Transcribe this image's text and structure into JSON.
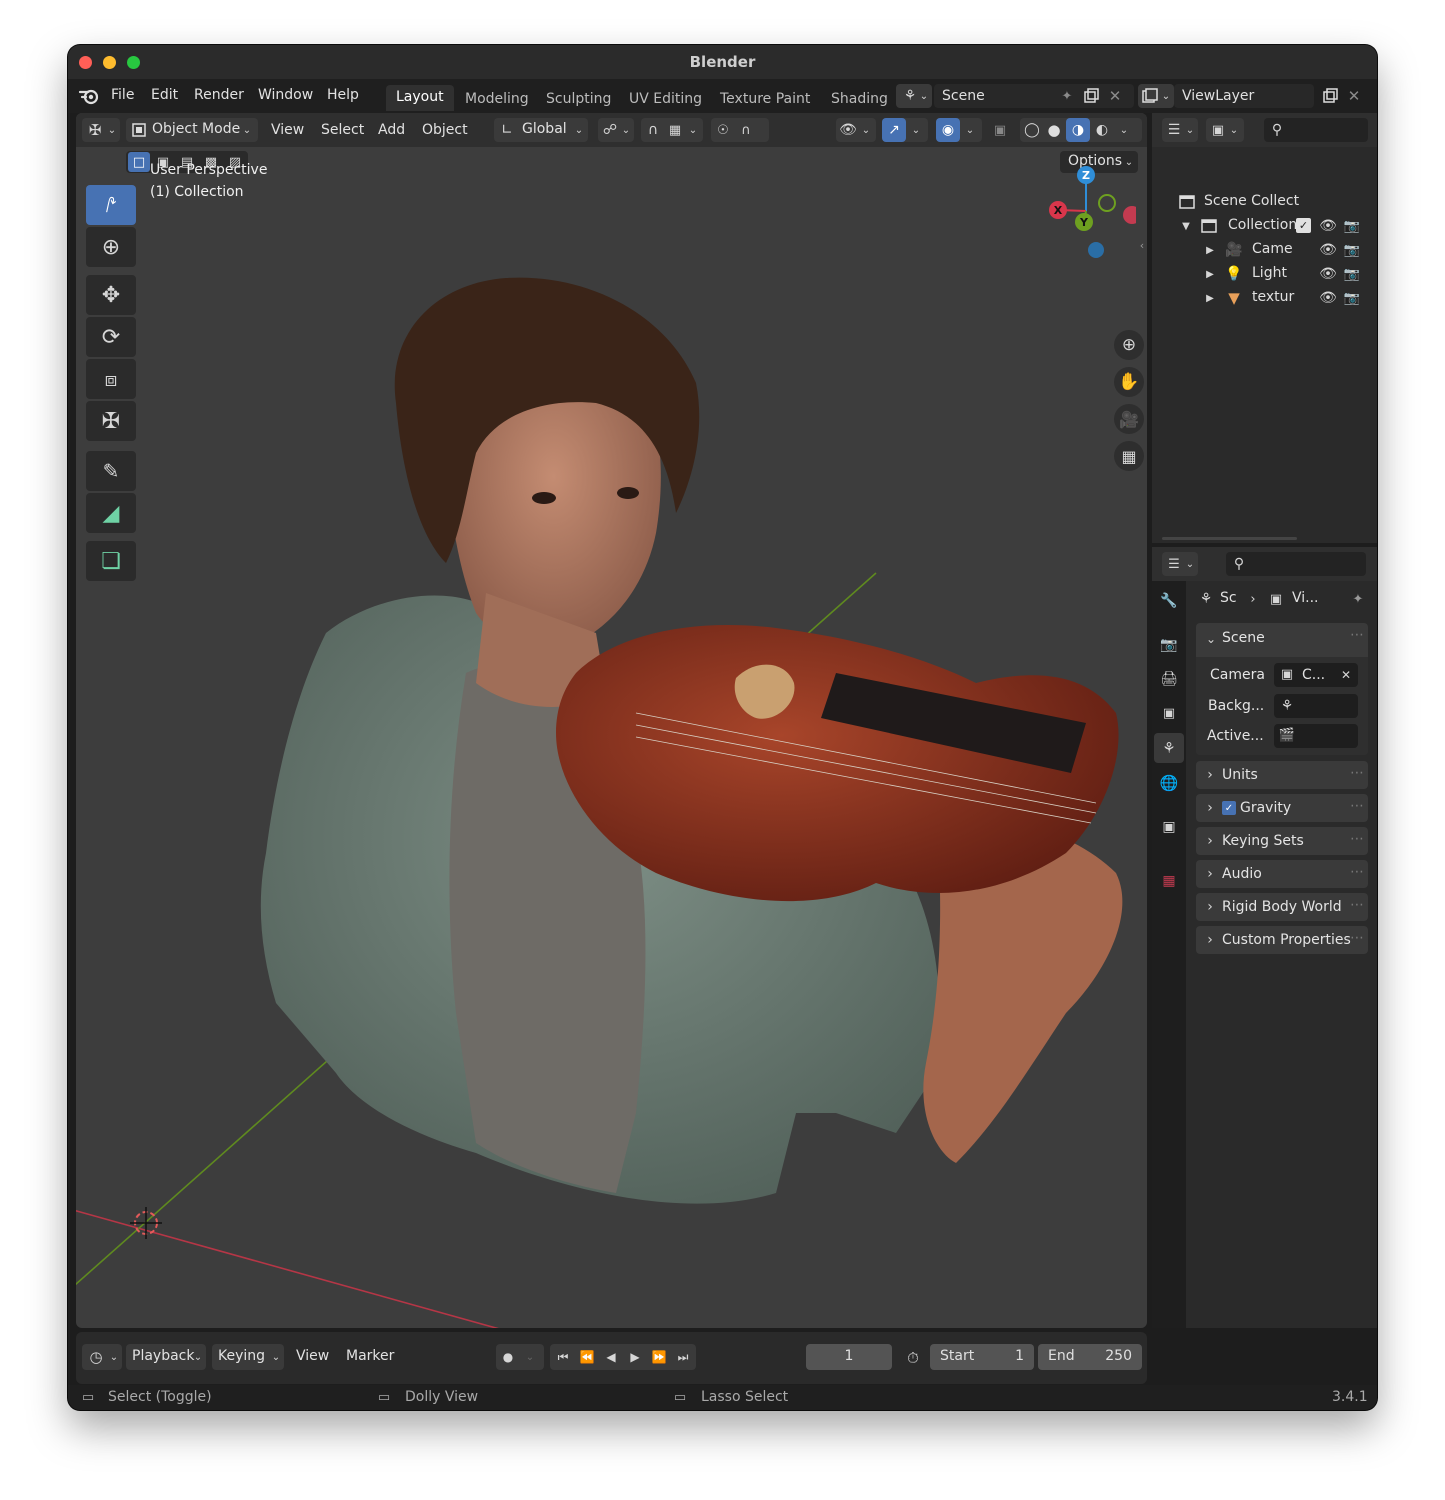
{
  "window": {
    "title": "Blender",
    "version": "3.4.1"
  },
  "menubar": {
    "items": [
      "File",
      "Edit",
      "Render",
      "Window",
      "Help"
    ],
    "workspaces": [
      "Layout",
      "Modeling",
      "Sculpting",
      "UV Editing",
      "Texture Paint",
      "Shading"
    ],
    "active_workspace": "Layout",
    "scene_name": "Scene",
    "view_layer": "ViewLayer"
  },
  "viewport": {
    "mode": "Object Mode",
    "menus": [
      "View",
      "Select",
      "Add",
      "Object"
    ],
    "transform_orientation": "Global",
    "options_label": "Options",
    "overlay_title": "User Perspective",
    "overlay_subtitle": "(1) Collection",
    "gizmo_axes": {
      "x": "X",
      "y": "Y",
      "z": "Z"
    },
    "tools": [
      "select-box",
      "cursor",
      "move",
      "rotate",
      "scale",
      "transform",
      "annotate",
      "measure",
      "add-cube"
    ]
  },
  "outliner": {
    "root": "Scene Collect",
    "collection": "Collection",
    "items": [
      "Came",
      "Light",
      "textur"
    ]
  },
  "properties": {
    "breadcrumb": [
      "Sc",
      "Vi..."
    ],
    "panel_title": "Scene",
    "fields": [
      {
        "label": "Camera",
        "value": "C..."
      },
      {
        "label": "Backg...",
        "value": ""
      },
      {
        "label": "Active...",
        "value": ""
      }
    ],
    "sections": [
      "Units",
      "Gravity",
      "Keying Sets",
      "Audio",
      "Rigid Body World",
      "Custom Properties"
    ],
    "gravity_checked": true
  },
  "timeline": {
    "menus": [
      "Playback",
      "Keying",
      "View",
      "Marker"
    ],
    "current_frame": "1",
    "start_label": "Start",
    "start": "1",
    "end_label": "End",
    "end": "250"
  },
  "statusbar": {
    "hints": [
      "Select (Toggle)",
      "Dolly View",
      "Lasso Select"
    ]
  },
  "colors": {
    "accent": "#4772b3",
    "x_axis": "#d9364b",
    "y_axis": "#6ea020",
    "z_axis": "#2f8ed8",
    "viewport_bg": "#3d3d3d"
  }
}
